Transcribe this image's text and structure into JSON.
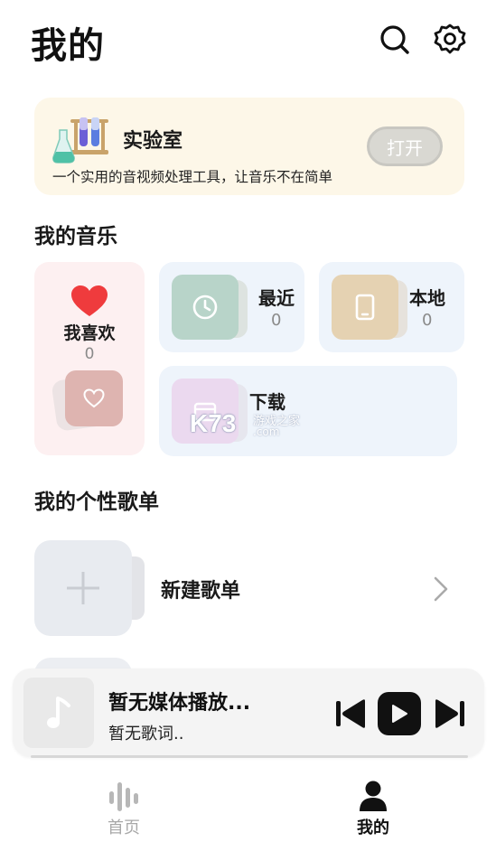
{
  "header": {
    "title": "我的",
    "search_icon": "search-icon",
    "settings_icon": "gear-icon"
  },
  "lab": {
    "title": "实验室",
    "description": "一个实用的音视频处理工具，让音乐不在简单",
    "button": "打开",
    "icon": "test-tubes-icon"
  },
  "music": {
    "section_title": "我的音乐",
    "favorites": {
      "label": "我喜欢",
      "count": "0",
      "icon": "heart-icon"
    },
    "recent": {
      "label": "最近",
      "count": "0",
      "icon": "clock-icon"
    },
    "local": {
      "label": "本地",
      "count": "0",
      "icon": "phone-icon"
    },
    "download": {
      "label": "下载",
      "icon": "download-icon"
    }
  },
  "watermark": {
    "logo": "K73",
    "site_cn": "游戏之家",
    "site_com": ".com"
  },
  "playlists": {
    "section_title": "我的个性歌单",
    "new_label": "新建歌单"
  },
  "player": {
    "title": "暂无媒体播放...",
    "subtitle": "暂无歌词.."
  },
  "nav": {
    "items": [
      {
        "label": "首页",
        "icon": "waveform-icon",
        "active": false
      },
      {
        "label": "我的",
        "icon": "user-icon",
        "active": true
      }
    ]
  },
  "colors": {
    "lab_bg": "#fdf7e8",
    "fav_bg": "#fdf0f1",
    "tile_bg": "#eef4fb",
    "heart": "#ef3b3d",
    "recent_thumb": "#b8d4c9",
    "local_thumb": "#e5d2b2",
    "fav_thumb": "#deb4b0"
  }
}
